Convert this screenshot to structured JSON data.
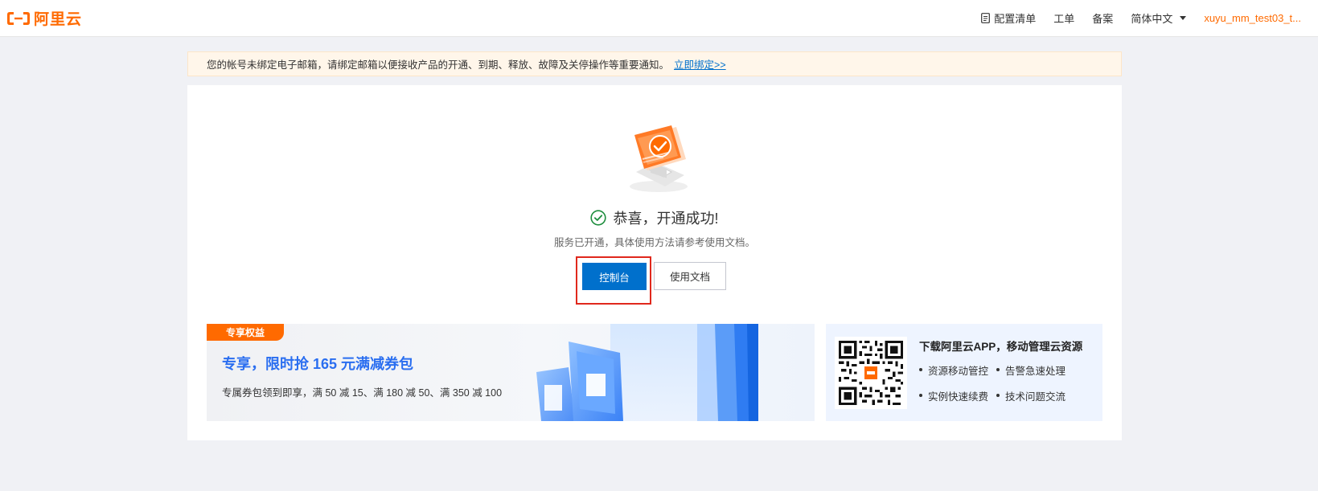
{
  "header": {
    "logo_text": "阿里云",
    "nav": {
      "config_list": "配置清单",
      "ticket": "工单",
      "filing": "备案",
      "language": "简体中文",
      "user": "xuyu_mm_test03_t..."
    }
  },
  "notice": {
    "text": "您的帐号未绑定电子邮箱，请绑定邮箱以便接收产品的开通、到期、释放、故障及关停操作等重要通知。",
    "link": "立即绑定>>"
  },
  "result": {
    "title": "恭喜，开通成功!",
    "subtitle": "服务已开通，具体使用方法请参考使用文档。",
    "primary_button": "控制台",
    "secondary_button": "使用文档"
  },
  "promo": {
    "tag": "专享权益",
    "title": "专享，限时抢 165 元满减券包",
    "description": "专属券包领到即享，满 50 减 15、满 180 减 50、满 350 减 100"
  },
  "app": {
    "title": "下载阿里云APP，移动管理云资源",
    "features": [
      "资源移动管控",
      "告警急速处理",
      "实例快速续费",
      "技术问题交流"
    ]
  },
  "colors": {
    "brand": "#ff6a00",
    "primary": "#0070cc",
    "success": "#1e8e3e",
    "highlight": "#e0281c"
  }
}
